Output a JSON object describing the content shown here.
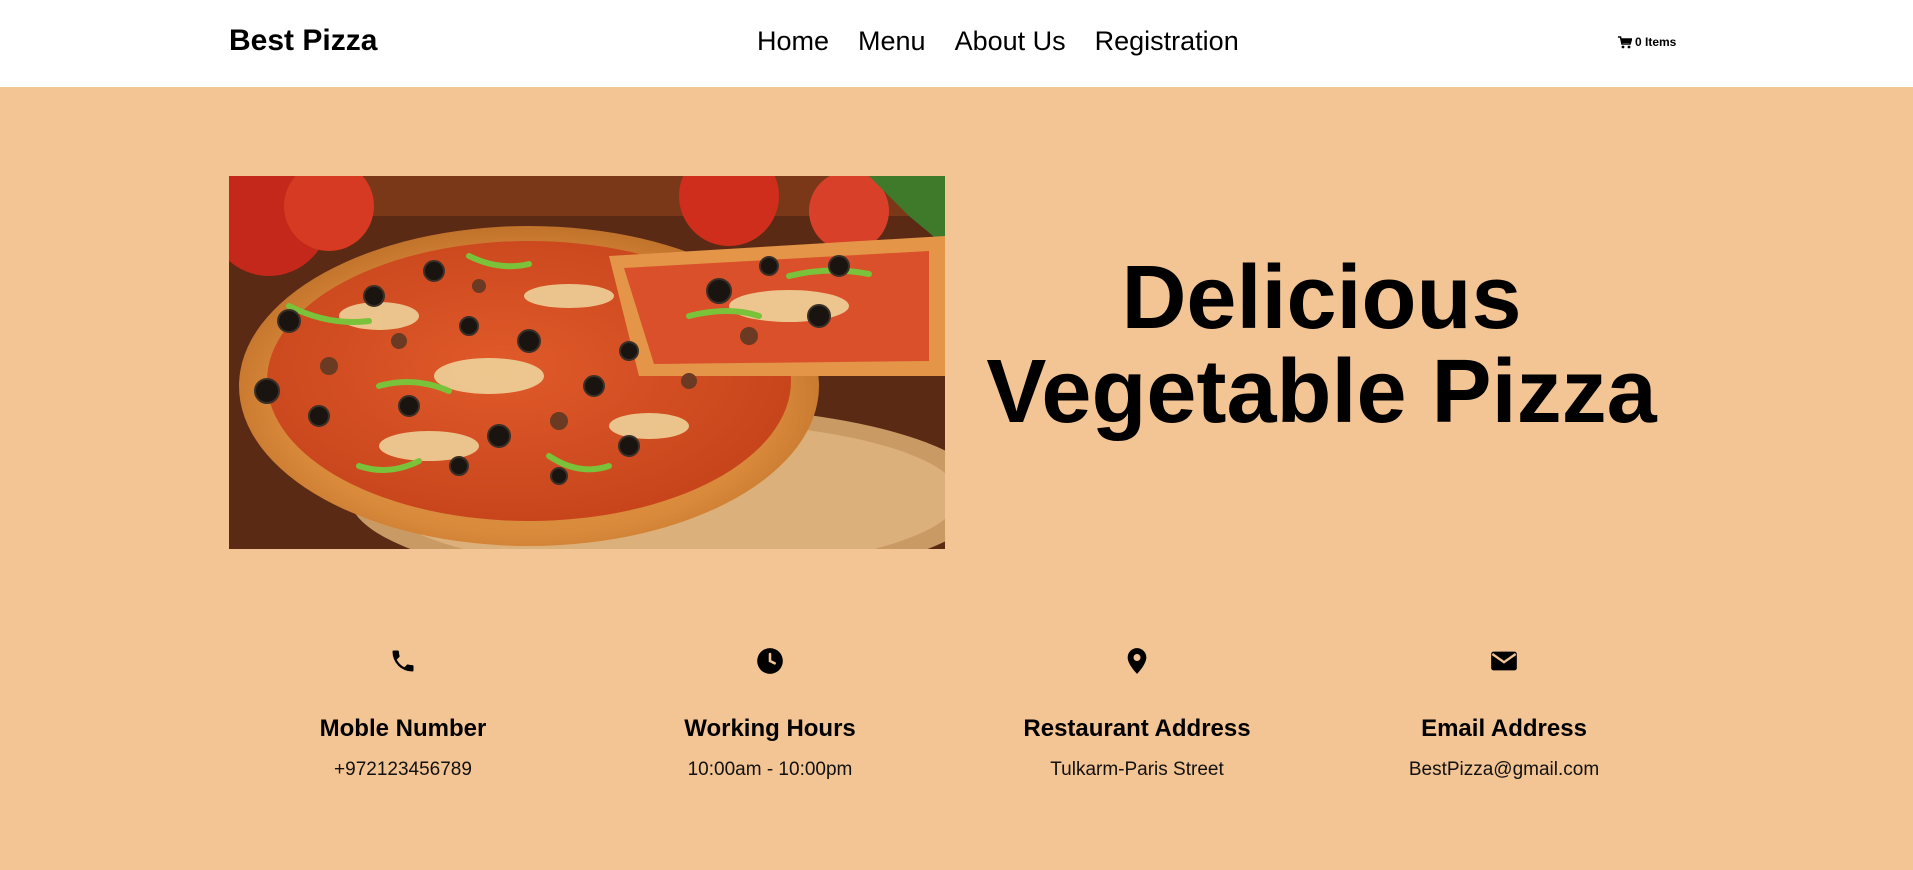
{
  "navbar": {
    "brand": "Best Pizza",
    "links": [
      "Home",
      "Menu",
      "About Us",
      "Registration"
    ],
    "cart_label": "0 Items"
  },
  "hero": {
    "title_line1": "Delicious",
    "title_line2": "Vegetable Pizza",
    "image_alt": "pizza-photo",
    "background_color": "#f3c494"
  },
  "info": [
    {
      "icon": "phone-icon",
      "heading": "Moble Number",
      "value": "+972123456789"
    },
    {
      "icon": "clock-icon",
      "heading": "Working Hours",
      "value": "10:00am - 10:00pm"
    },
    {
      "icon": "map-pin-icon",
      "heading": "Restaurant Address",
      "value": "Tulkarm-Paris Street"
    },
    {
      "icon": "envelope-icon",
      "heading": "Email Address",
      "value": "BestPizza@gmail.com"
    }
  ]
}
